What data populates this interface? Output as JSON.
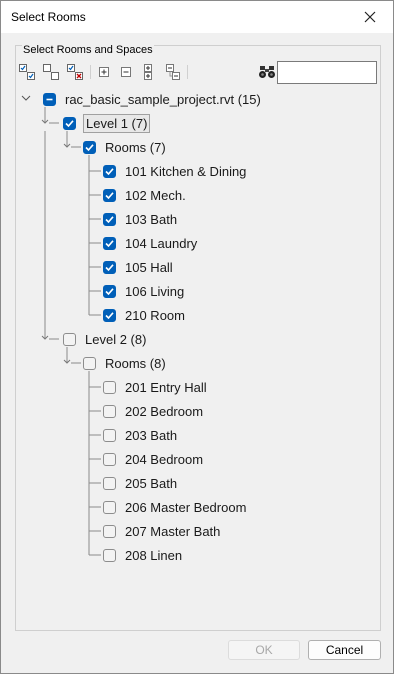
{
  "window": {
    "title": "Select Rooms"
  },
  "group": {
    "label": "Select Rooms and Spaces"
  },
  "toolbar": {
    "buttons": [
      "check-all-icon",
      "uncheck-all-icon",
      "invert-check-icon",
      "expand-icon",
      "collapse-icon",
      "expand-all-icon",
      "collapse-all-icon"
    ],
    "search_value": ""
  },
  "tree": {
    "root": {
      "label": "rac_basic_sample_project.rvt (15)",
      "state": "indeterminate"
    },
    "levels": [
      {
        "label": "Level 1 (7)",
        "state": "checked",
        "selected": true,
        "group_label": "Rooms (7)",
        "group_state": "checked",
        "rooms": [
          {
            "label": "101 Kitchen & Dining",
            "state": "checked"
          },
          {
            "label": "102 Mech.",
            "state": "checked"
          },
          {
            "label": "103 Bath",
            "state": "checked"
          },
          {
            "label": "104 Laundry",
            "state": "checked"
          },
          {
            "label": "105 Hall",
            "state": "checked"
          },
          {
            "label": "106 Living",
            "state": "checked"
          },
          {
            "label": "210 Room",
            "state": "checked"
          }
        ]
      },
      {
        "label": "Level 2 (8)",
        "state": "unchecked",
        "selected": false,
        "group_label": "Rooms (8)",
        "group_state": "unchecked",
        "rooms": [
          {
            "label": "201 Entry Hall",
            "state": "unchecked"
          },
          {
            "label": "202 Bedroom",
            "state": "unchecked"
          },
          {
            "label": "203 Bath",
            "state": "unchecked"
          },
          {
            "label": "204 Bedroom",
            "state": "unchecked"
          },
          {
            "label": "205 Bath",
            "state": "unchecked"
          },
          {
            "label": "206 Master Bedroom",
            "state": "unchecked"
          },
          {
            "label": "207 Master Bath",
            "state": "unchecked"
          },
          {
            "label": "208 Linen",
            "state": "unchecked"
          }
        ]
      }
    ]
  },
  "footer": {
    "ok_label": "OK",
    "ok_enabled": false,
    "cancel_label": "Cancel"
  },
  "colors": {
    "accent": "#005fb8",
    "background": "#f0f0f0"
  }
}
